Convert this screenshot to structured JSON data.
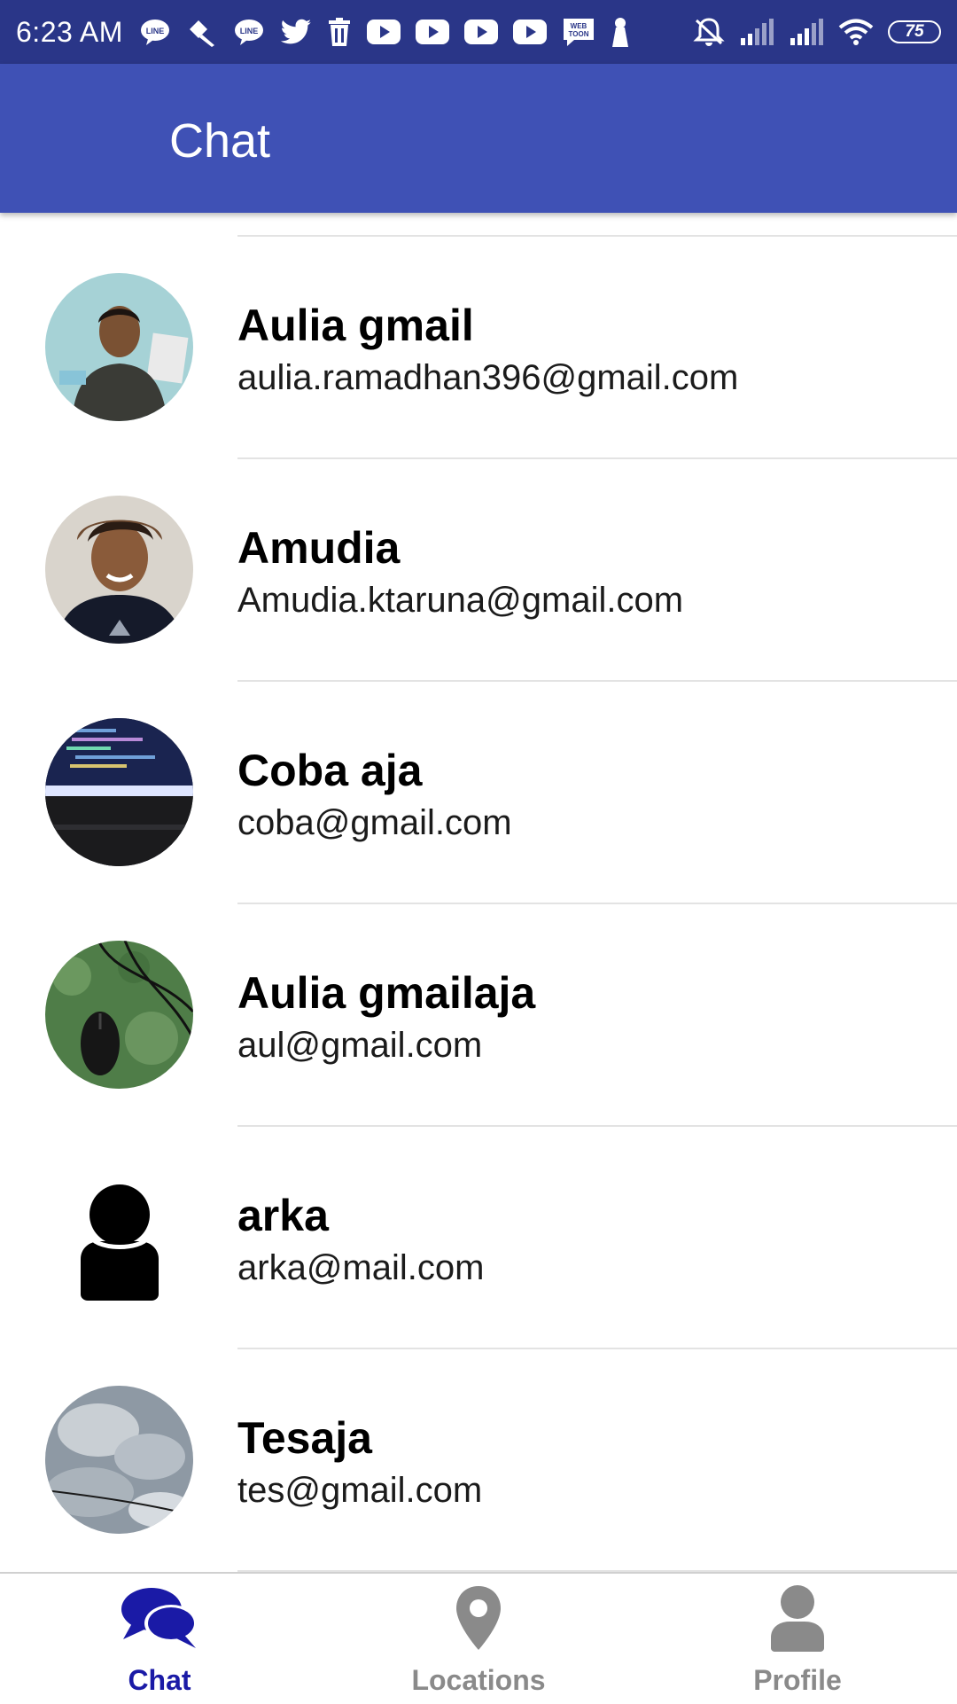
{
  "status_bar": {
    "time": "6:23 AM",
    "battery": "75",
    "notification_icons": [
      "line-icon",
      "pen-icon",
      "line-icon",
      "twitter-icon",
      "trash-icon",
      "youtube-icon",
      "youtube-icon",
      "youtube-icon",
      "youtube-icon",
      "webtoon-icon",
      "tower-icon"
    ],
    "system_icons": [
      "mute-icon",
      "signal-icon",
      "signal-icon",
      "wifi-icon"
    ],
    "colors": {
      "background": "#2a3688"
    }
  },
  "app_bar": {
    "title": "Chat",
    "color": "#3f51b5"
  },
  "contacts": [
    {
      "name": "Aulia gmail",
      "email": "aulia.ramadhan396@gmail.com",
      "avatar": "photo-person-holding-paper"
    },
    {
      "name": "Amudia",
      "email": "Amudia.ktaruna@gmail.com",
      "avatar": "photo-smiling-person"
    },
    {
      "name": "Coba aja",
      "email": "coba@gmail.com",
      "avatar": "photo-laptop-screen"
    },
    {
      "name": "Aulia gmailaja",
      "email": "aul@gmail.com",
      "avatar": "photo-mouse-on-mat"
    },
    {
      "name": "arka",
      "email": "arka@mail.com",
      "avatar": "default-person-icon"
    },
    {
      "name": "Tesaja",
      "email": "tes@gmail.com",
      "avatar": "photo-cloudy-sky"
    }
  ],
  "bottom_nav": {
    "items": [
      {
        "label": "Chat",
        "icon": "chat-bubbles-icon",
        "active": true
      },
      {
        "label": "Locations",
        "icon": "location-pin-icon",
        "active": false
      },
      {
        "label": "Profile",
        "icon": "person-icon",
        "active": false
      }
    ],
    "active_color": "#1a1aa6",
    "inactive_color": "#8a8a8a"
  }
}
